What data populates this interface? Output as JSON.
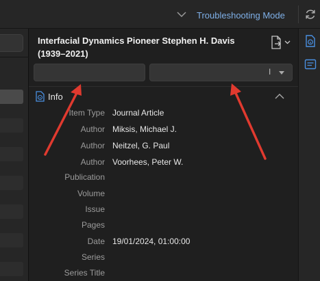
{
  "topbar": {
    "troubleshooting_label": "Troubleshooting Mode",
    "chevron_icon": "chevron-down-icon",
    "sync_icon": "sync-icon"
  },
  "item": {
    "title": "Interfacial Dynamics Pioneer Stephen H. Davis (1939–2021)",
    "doc_menu_icon": "document-arrow-icon"
  },
  "header_inputs": {
    "first_value": "",
    "second_value": "I"
  },
  "info_section": {
    "title": "Info",
    "icon": "info-document-icon",
    "collapse_icon": "chevron-up-icon",
    "fields": [
      {
        "label": "Item Type",
        "value": "Journal Article"
      },
      {
        "label": "Author",
        "value": "Miksis, Michael J."
      },
      {
        "label": "Author",
        "value": "Neitzel, G. Paul"
      },
      {
        "label": "Author",
        "value": "Voorhees, Peter W."
      },
      {
        "label": "Publication",
        "value": ""
      },
      {
        "label": "Volume",
        "value": ""
      },
      {
        "label": "Issue",
        "value": ""
      },
      {
        "label": "Pages",
        "value": ""
      },
      {
        "label": "Date",
        "value": "19/01/2024, 01:00:00"
      },
      {
        "label": "Series",
        "value": ""
      },
      {
        "label": "Series Title",
        "value": ""
      }
    ]
  },
  "colors": {
    "background": "#1f1f1f",
    "accent_text": "#7fb0e8",
    "arrow": "#e03a2f",
    "icon_blue": "#4a90e2"
  }
}
